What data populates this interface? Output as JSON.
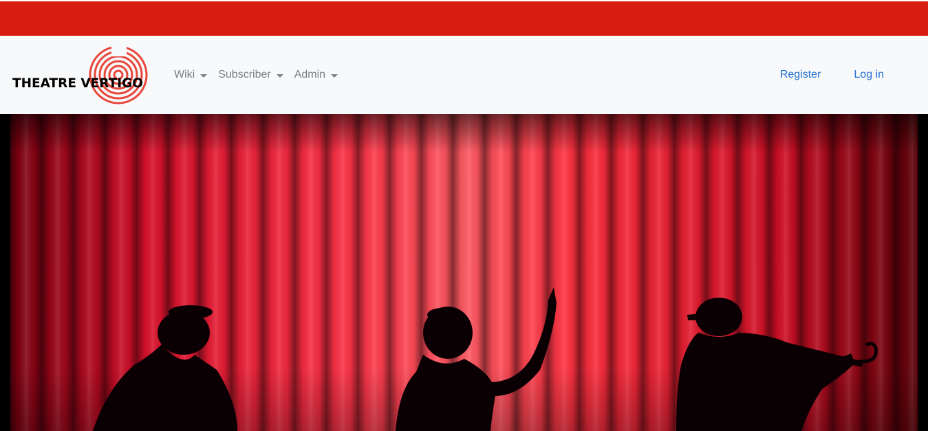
{
  "brand": {
    "name": "THEATRE VERTIGO",
    "logo_color": "#e8463a"
  },
  "nav": {
    "left": [
      {
        "label": "Wiki"
      },
      {
        "label": "Subscriber"
      },
      {
        "label": "Admin"
      }
    ],
    "right": {
      "register": "Register",
      "login": "Log in"
    }
  },
  "colors": {
    "top_bar": "#d91c12",
    "navbar_bg": "#f8f9fa",
    "link": "#1f6fd1",
    "dropdown_text": "#7b7f83"
  },
  "hero": {
    "image_description_icon": "stage-curtain-silhouettes"
  }
}
